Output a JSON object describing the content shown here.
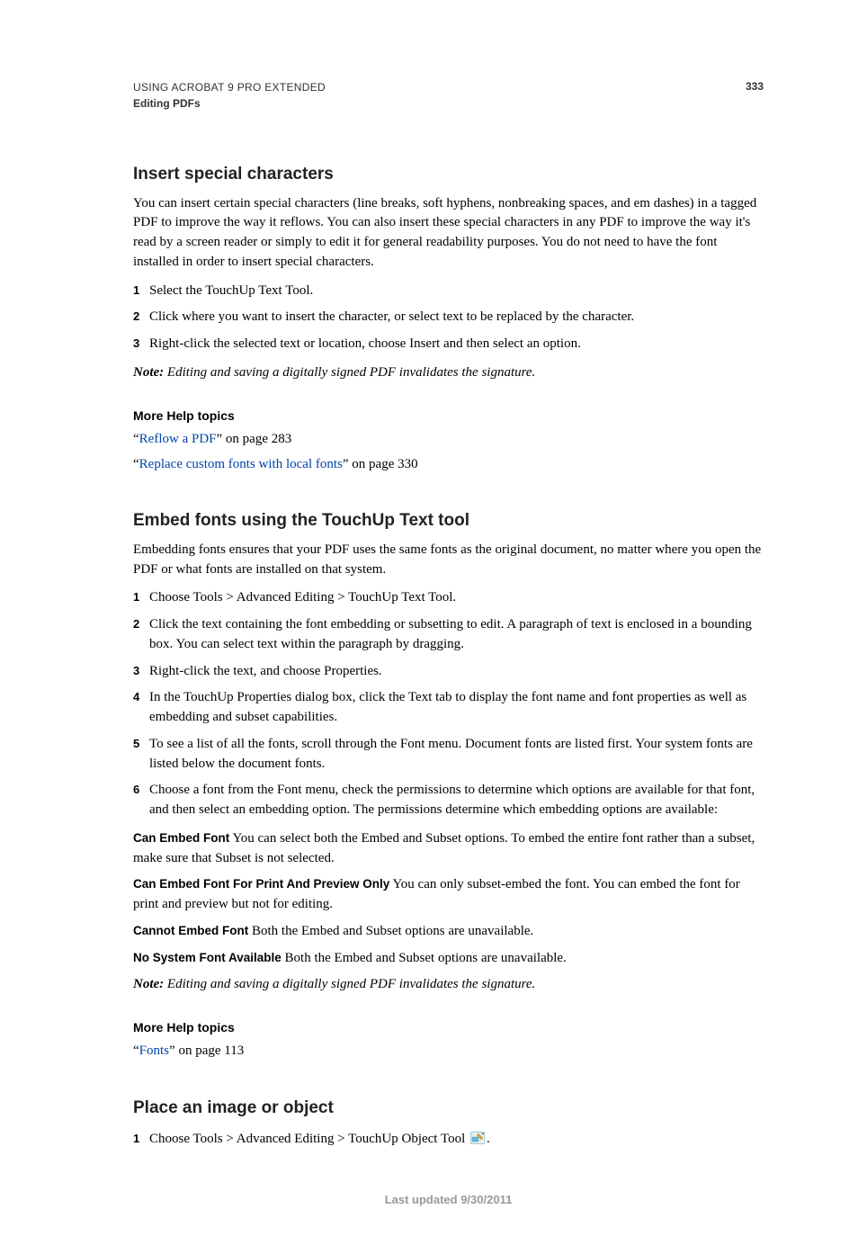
{
  "header": {
    "title": "USING ACROBAT 9 PRO EXTENDED",
    "subtitle": "Editing PDFs",
    "page_number": "333"
  },
  "section1": {
    "heading": "Insert special characters",
    "intro": "You can insert certain special characters (line breaks, soft hyphens, nonbreaking spaces, and em dashes) in a tagged PDF to improve the way it reflows. You can also insert these special characters in any PDF to improve the way it's read by a screen reader or simply to edit it for general readability purposes. You do not need to have the font installed in order to insert special characters.",
    "steps": [
      "Select the TouchUp Text Tool.",
      "Click where you want to insert the character, or select text to be replaced by the character.",
      "Right-click the selected text or location, choose Insert and then select an option."
    ],
    "note_label": "Note:",
    "note_text": " Editing and saving a digitally signed PDF invalidates the signature.",
    "more_help_heading": "More Help topics",
    "help1_q1": "“",
    "help1_link": "Reflow a PDF",
    "help1_tail": "” on page 283",
    "help2_q1": "“",
    "help2_link": "Replace custom fonts with local fonts",
    "help2_tail": "” on page 330"
  },
  "section2": {
    "heading": "Embed fonts using the TouchUp Text tool",
    "intro": "Embedding fonts ensures that your PDF uses the same fonts as the original document, no matter where you open the PDF or what fonts are installed on that system.",
    "steps": [
      "Choose Tools > Advanced Editing > TouchUp Text Tool.",
      "Click the text containing the font embedding or subsetting to edit. A paragraph of text is enclosed in a bounding box. You can select text within the paragraph by dragging.",
      "Right-click the text, and choose Properties.",
      "In the TouchUp Properties dialog box, click the Text tab to display the font name and font properties as well as embedding and subset capabilities.",
      "To see a list of all the fonts, scroll through the Font menu. Document fonts are listed first. Your system fonts are listed below the document fonts.",
      "Choose a font from the Font menu, check the permissions to determine which options are available for that font, and then select an embedding option. The permissions determine which embedding options are available:"
    ],
    "term1_label": "Can Embed Font",
    "term1_text": "  You can select both the Embed and Subset options. To embed the entire font rather than a subset, make sure that Subset is not selected.",
    "term2_label": "Can Embed Font For Print And Preview Only",
    "term2_text": "  You can only subset-embed the font. You can embed the font for print and preview but not for editing.",
    "term3_label": "Cannot Embed Font",
    "term3_text": "  Both the Embed and Subset options are unavailable.",
    "term4_label": "No System Font Available",
    "term4_text": "  Both the Embed and Subset options are unavailable.",
    "note_label": "Note:",
    "note_text": " Editing and saving a digitally signed PDF invalidates the signature.",
    "more_help_heading": "More Help topics",
    "help1_q1": "“",
    "help1_link": "Fonts",
    "help1_tail": "” on page 113"
  },
  "section3": {
    "heading": "Place an image or object",
    "step1_num": "1",
    "step1_text_pre": "Choose Tools > Advanced Editing > TouchUp Object Tool ",
    "step1_text_post": "."
  },
  "footer": {
    "text": "Last updated 9/30/2011"
  },
  "nums": {
    "n1": "1",
    "n2": "2",
    "n3": "3",
    "n4": "4",
    "n5": "5",
    "n6": "6"
  }
}
